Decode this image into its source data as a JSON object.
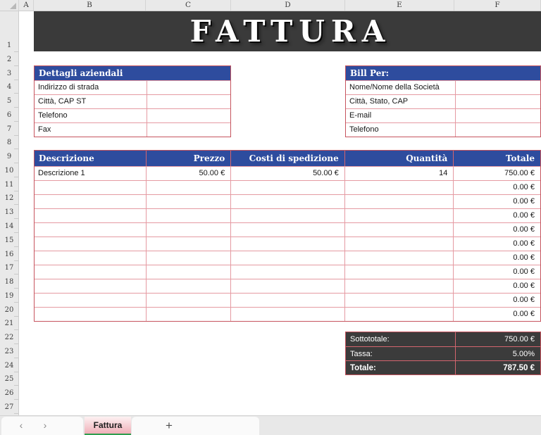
{
  "spreadsheet": {
    "column_headers": [
      "A",
      "B",
      "C",
      "D",
      "E",
      "F"
    ],
    "row_numbers": [
      1,
      2,
      3,
      4,
      5,
      6,
      7,
      8,
      9,
      10,
      11,
      12,
      13,
      14,
      15,
      16,
      17,
      18,
      19,
      20,
      21,
      22,
      23,
      24,
      25,
      26,
      27
    ],
    "banner": {
      "title": "FATTURA"
    },
    "company_table": {
      "title": "Dettagli aziendali",
      "fields": [
        "Indirizzo di strada",
        "Città, CAP ST",
        "Telefono",
        "Fax"
      ]
    },
    "billto_table": {
      "title": "Bill Per:",
      "fields": [
        "Nome/Nome della Società",
        "Città, Stato, CAP",
        "E-mail",
        "Telefono"
      ]
    },
    "items_table": {
      "headers": [
        "Descrizione",
        "Prezzo",
        "Costi di spedizione",
        "Quantità",
        "Totale"
      ],
      "rows": [
        [
          "Descrizione 1",
          "50.00 €",
          "50.00 €",
          "14",
          "750.00 €"
        ],
        [
          "",
          "",
          "",
          "",
          "0.00 €"
        ],
        [
          "",
          "",
          "",
          "",
          "0.00 €"
        ],
        [
          "",
          "",
          "",
          "",
          "0.00 €"
        ],
        [
          "",
          "",
          "",
          "",
          "0.00 €"
        ],
        [
          "",
          "",
          "",
          "",
          "0.00 €"
        ],
        [
          "",
          "",
          "",
          "",
          "0.00 €"
        ],
        [
          "",
          "",
          "",
          "",
          "0.00 €"
        ],
        [
          "",
          "",
          "",
          "",
          "0.00 €"
        ],
        [
          "",
          "",
          "",
          "",
          "0.00 €"
        ],
        [
          "",
          "",
          "",
          "",
          "0.00 €"
        ]
      ]
    },
    "summary_table": {
      "rows": [
        {
          "label": "Sottototale:",
          "value": "750.00 €",
          "bold": false
        },
        {
          "label": "Tassa:",
          "value": "5.00%",
          "bold": false
        },
        {
          "label": "Totale:",
          "value": "787.50 €",
          "bold": true
        }
      ]
    },
    "tab_bar": {
      "prev_icon": "‹",
      "next_icon": "›",
      "active_tab": "Fattura",
      "add_icon": "+"
    },
    "colors": {
      "accent_blue": "#2e4c9e",
      "dark_panel": "#3a3a3a",
      "border_red": "#c6545e",
      "border_red_light": "#e59aa2",
      "tab_green": "#2f9e4f",
      "active_tab_pink": "#eea7b1"
    }
  }
}
